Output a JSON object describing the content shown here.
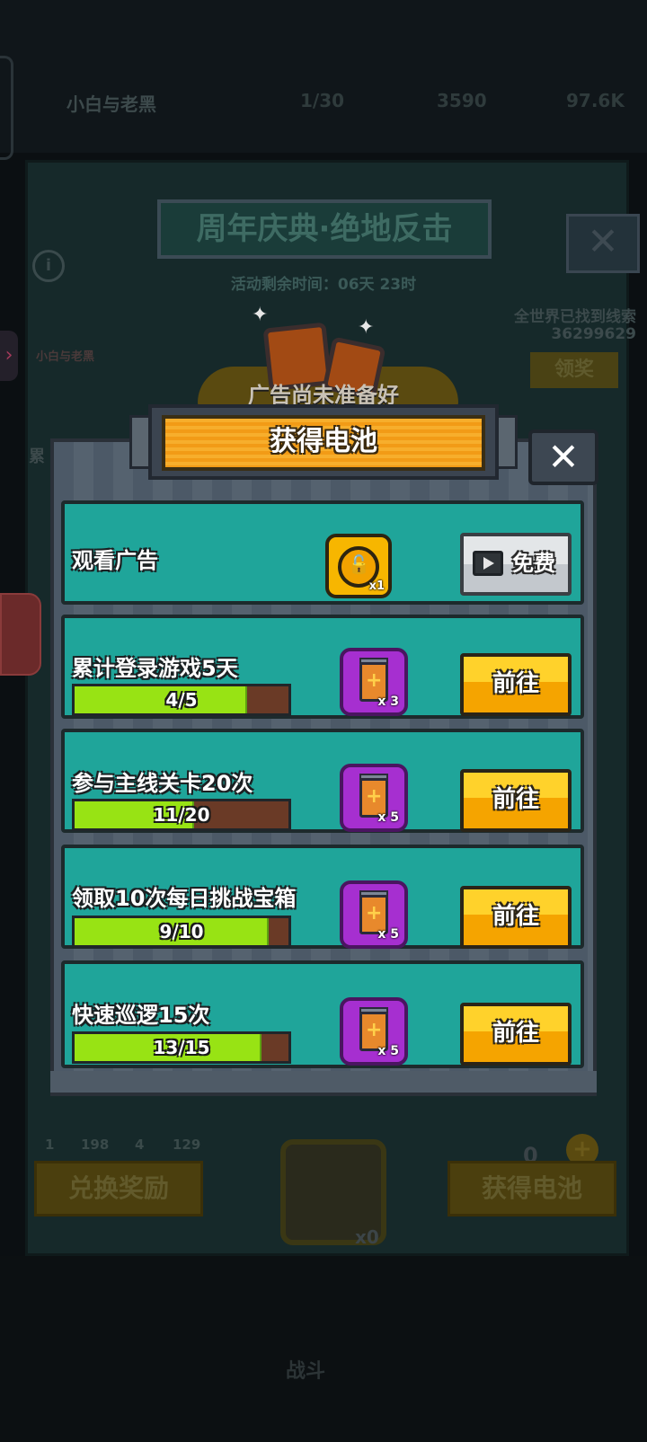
{
  "background": {
    "player_name": "小白与老黑",
    "top_stats": [
      "1/30",
      "3590",
      "97.6K"
    ],
    "event_title": "周年庆典·绝地反击",
    "event_timer": "活动剩余时间：06天 23时",
    "clue_label": "全世界已找到线索",
    "clue_count": "36299629",
    "claim_label": "领奖",
    "left_char_label": "小白与老黑",
    "left_partial": "累",
    "gems": [
      "1",
      "198",
      "4",
      "129"
    ],
    "exchange_label": "兑换奖励",
    "lock_count": "x0",
    "battery_count": "0",
    "get_battery_label": "获得电池",
    "nav_label": "战斗"
  },
  "banner": {
    "ad_not_ready": "广告尚未准备好"
  },
  "modal": {
    "title": "获得电池",
    "close": "✕",
    "ad_row": {
      "label": "观看广告",
      "reward_qty": "x1",
      "button_label": "免费"
    },
    "tasks": [
      {
        "label": "累计登录游戏5天",
        "progress_text": "4/5",
        "progress": 0.8,
        "reward_qty": "x 3",
        "button_label": "前往"
      },
      {
        "label": "参与主线关卡20次",
        "progress_text": "11/20",
        "progress": 0.55,
        "reward_qty": "x 5",
        "button_label": "前往"
      },
      {
        "label": "领取10次每日挑战宝箱",
        "progress_text": "9/10",
        "progress": 0.9,
        "reward_qty": "x 5",
        "button_label": "前往"
      },
      {
        "label": "快速巡逻15次",
        "progress_text": "13/15",
        "progress": 0.867,
        "reward_qty": "x 5",
        "button_label": "前往"
      }
    ]
  },
  "colors": {
    "accent_orange": "#f5a623",
    "row_teal": "#1fa59a",
    "progress_green": "#98e314",
    "reward_purple": "#a62fd0"
  }
}
